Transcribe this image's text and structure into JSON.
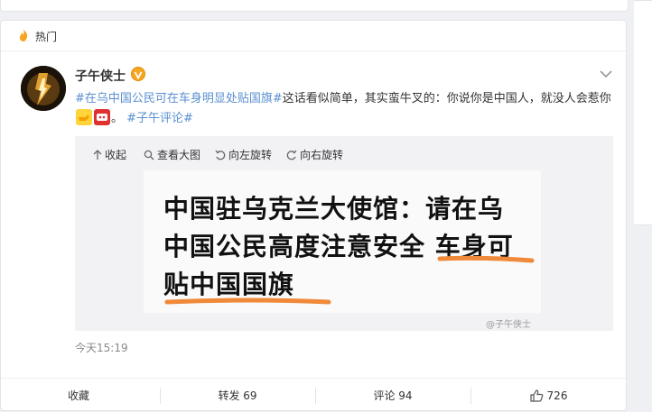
{
  "hot": {
    "label": "热门"
  },
  "post": {
    "author": "子午侠士",
    "text_tag": "#在乌中国公民可在车身明显处贴国旗#",
    "text_body": "这话看似简单，其实蛮牛叉的：你说你是中国人，就没人会惹你",
    "text_tail": "。",
    "text_tag2": "#子午评论#",
    "time": "今天15:19"
  },
  "media_toolbar": {
    "collapse": "收起",
    "view_large": "查看大图",
    "rotate_left": "向左旋转",
    "rotate_right": "向右旋转"
  },
  "image": {
    "line1": "中国驻乌克兰大使馆：请在乌",
    "line2_a": "中国公民高度注意安全 ",
    "line2_b": "车身可",
    "line3": "贴中国国旗",
    "watermark": "@子午侠士"
  },
  "actions": {
    "favorite": "收藏",
    "repost": "转发 69",
    "comment": "评论 94",
    "like": "726"
  },
  "colors": {
    "tag": "#5a8fd0",
    "underline": "#f08a3a",
    "badge": "#f5a623"
  }
}
